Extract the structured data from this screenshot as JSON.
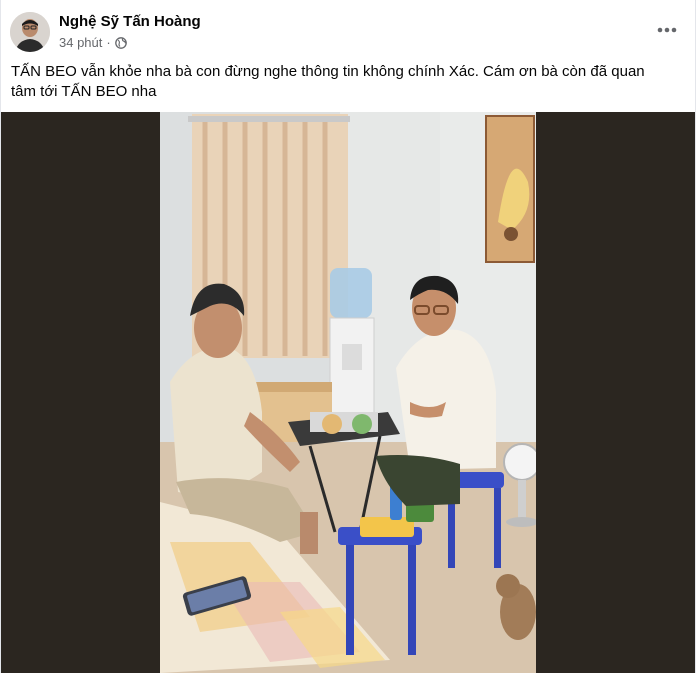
{
  "post": {
    "author_name": "Nghệ Sỹ Tấn Hoàng",
    "timestamp": "34 phút",
    "separator": "·",
    "privacy_icon": "globe-icon",
    "more_icon": "more-options-icon",
    "text": "TẤN BEO vẫn khỏe nha bà con đừng nghe thông tin không chính Xác. Cám ơn bà còn đã quan tâm tới TẤN BEO nha",
    "photo_description": "photo-two-men-sitting-at-table"
  },
  "colors": {
    "text_primary": "#050505",
    "text_secondary": "#65676b",
    "media_background": "#2b2620"
  }
}
